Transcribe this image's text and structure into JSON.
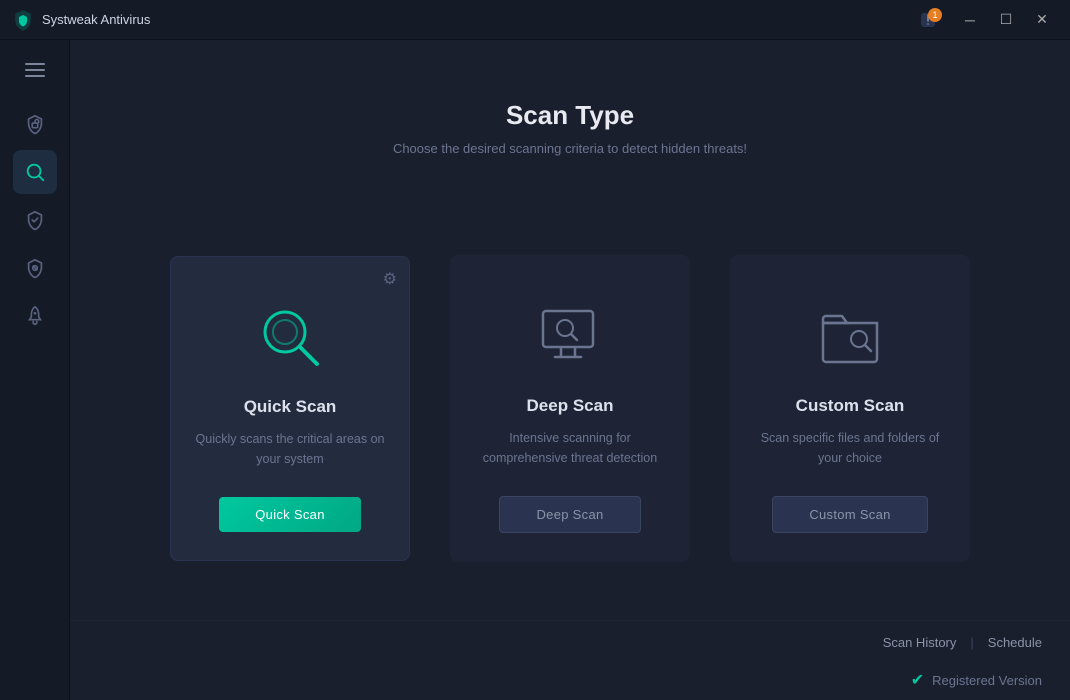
{
  "titlebar": {
    "app_name": "Systweak Antivirus",
    "notification_count": "1",
    "minimize_label": "─",
    "maximize_label": "☐",
    "close_label": "✕"
  },
  "sidebar": {
    "hamburger_label": "menu",
    "items": [
      {
        "id": "protection",
        "icon": "shield-lock",
        "label": "Protection",
        "active": false
      },
      {
        "id": "scan",
        "icon": "search",
        "label": "Scan",
        "active": true
      },
      {
        "id": "checkmark",
        "icon": "shield-check",
        "label": "Security",
        "active": false
      },
      {
        "id": "blocked",
        "icon": "shield-block",
        "label": "Block",
        "active": false
      },
      {
        "id": "booster",
        "icon": "rocket",
        "label": "Boost",
        "active": false
      }
    ]
  },
  "page": {
    "title": "Scan Type",
    "subtitle": "Choose the desired scanning criteria to detect hidden threats!"
  },
  "scan_cards": [
    {
      "id": "quick",
      "title": "Quick Scan",
      "description": "Quickly scans the critical areas on your system",
      "button_label": "Quick Scan",
      "button_type": "primary",
      "active": true,
      "has_settings": true
    },
    {
      "id": "deep",
      "title": "Deep Scan",
      "description": "Intensive scanning for comprehensive threat detection",
      "button_label": "Deep Scan",
      "button_type": "secondary",
      "active": false,
      "has_settings": false
    },
    {
      "id": "custom",
      "title": "Custom Scan",
      "description": "Scan specific files and folders of your choice",
      "button_label": "Custom Scan",
      "button_type": "secondary",
      "active": false,
      "has_settings": false
    }
  ],
  "footer": {
    "scan_history_label": "Scan History",
    "schedule_label": "Schedule"
  },
  "bottom": {
    "registered_text": "Registered Version"
  }
}
